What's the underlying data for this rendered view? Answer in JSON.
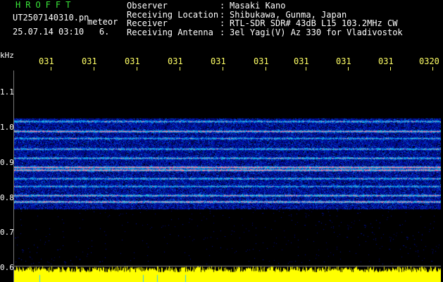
{
  "header": {
    "app_title": "HROFFT",
    "file_name": "UT2507140310.pn",
    "file_suffix": "meteor",
    "date_time": "25.07.14 03:10",
    "date_extra": "6."
  },
  "info": [
    {
      "label": "Observer",
      "sep": ":",
      "value": "Masaki Kano"
    },
    {
      "label": "Receiving Location",
      "sep": ":",
      "value": "Shibukawa, Gunma, Japan"
    },
    {
      "label": "Receiver",
      "sep": ":",
      "value": "RTL-SDR SDR# 43dB L15 103.2MHz CW"
    },
    {
      "label": "Receiving Antenna",
      "sep": ":",
      "value": "3el Yagi(V) Az 330 for Vladivostok"
    }
  ],
  "axis": {
    "freq_unit": "kHz",
    "freq_ticks": [
      "1.1",
      "1.0",
      "0.9",
      "0.8",
      "0.7",
      "0.6"
    ],
    "time_ticks": [
      "031",
      "031",
      "031",
      "031",
      "031",
      "031",
      "031",
      "031",
      "031",
      "0320"
    ]
  },
  "colors": {
    "title_green": "#39e639",
    "tick_yellow": "#ffff66",
    "background": "#000000",
    "noise_blue": "#1010a0",
    "signal_cyan": "#40c0ff",
    "signal_hot": "#ff4020",
    "level_yellow": "#ffff00"
  }
}
